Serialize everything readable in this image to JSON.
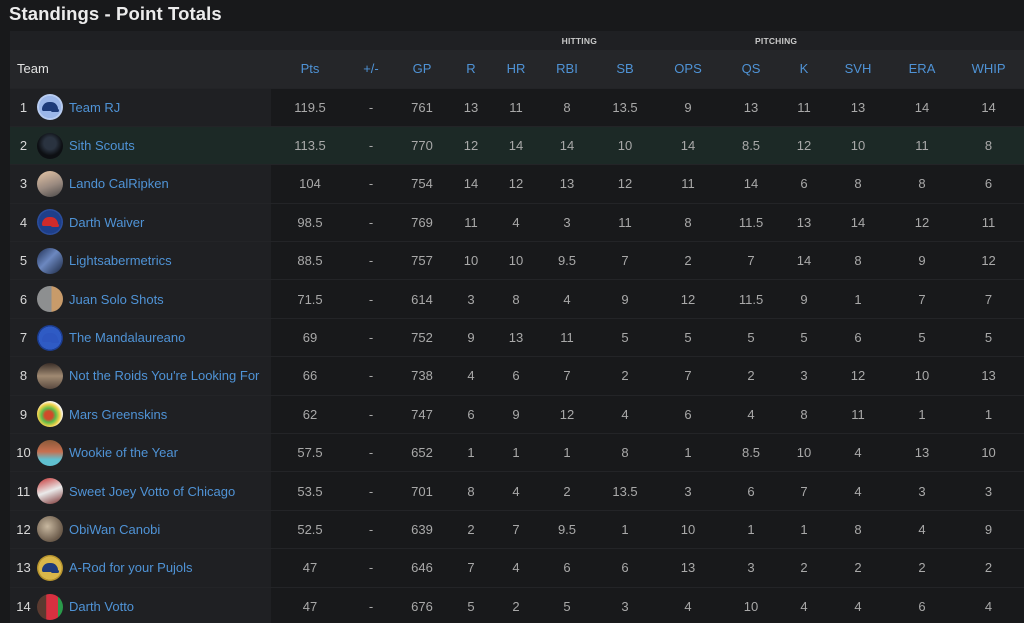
{
  "page": {
    "title": "Standings - Point Totals"
  },
  "colors": {
    "accent": "#4f93d6",
    "highlight_row": "#1c2926",
    "background": "#18191b"
  },
  "table": {
    "group_headers": {
      "hitting": "HITTING",
      "pitching": "PITCHING"
    },
    "columns": [
      "Team",
      "Pts",
      "+/-",
      "GP",
      "R",
      "HR",
      "RBI",
      "SB",
      "OPS",
      "QS",
      "K",
      "SVH",
      "ERA",
      "WHIP"
    ],
    "rows": [
      {
        "rank": "1",
        "team": "Team RJ",
        "avatar": "cap-blue-icon",
        "pts": "119.5",
        "change": "-",
        "gp": "761",
        "r": "13",
        "hr": "11",
        "rbi": "8",
        "sb": "13.5",
        "ops": "9",
        "qs": "13",
        "k": "11",
        "svh": "13",
        "era": "14",
        "whip": "14",
        "highlight": false
      },
      {
        "rank": "2",
        "team": "Sith Scouts",
        "avatar": "sith-photo-icon",
        "pts": "113.5",
        "change": "-",
        "gp": "770",
        "r": "12",
        "hr": "14",
        "rbi": "14",
        "sb": "10",
        "ops": "14",
        "qs": "8.5",
        "k": "12",
        "svh": "10",
        "era": "11",
        "whip": "8",
        "highlight": true
      },
      {
        "rank": "3",
        "team": "Lando CalRipken",
        "avatar": "person-photo-icon",
        "pts": "104",
        "change": "-",
        "gp": "754",
        "r": "14",
        "hr": "12",
        "rbi": "13",
        "sb": "12",
        "ops": "11",
        "qs": "14",
        "k": "6",
        "svh": "8",
        "era": "8",
        "whip": "6",
        "highlight": false
      },
      {
        "rank": "4",
        "team": "Darth Waiver",
        "avatar": "cap-red-icon",
        "pts": "98.5",
        "change": "-",
        "gp": "769",
        "r": "11",
        "hr": "4",
        "rbi": "3",
        "sb": "11",
        "ops": "8",
        "qs": "11.5",
        "k": "13",
        "svh": "14",
        "era": "12",
        "whip": "11",
        "highlight": false
      },
      {
        "rank": "5",
        "team": "Lightsabermetrics",
        "avatar": "lightsaber-photo-icon",
        "pts": "88.5",
        "change": "-",
        "gp": "757",
        "r": "10",
        "hr": "10",
        "rbi": "9.5",
        "sb": "7",
        "ops": "2",
        "qs": "7",
        "k": "14",
        "svh": "8",
        "era": "9",
        "whip": "12",
        "highlight": false
      },
      {
        "rank": "6",
        "team": "Juan Solo Shots",
        "avatar": "door-photo-icon",
        "pts": "71.5",
        "change": "-",
        "gp": "614",
        "r": "3",
        "hr": "8",
        "rbi": "4",
        "sb": "9",
        "ops": "12",
        "qs": "11.5",
        "k": "9",
        "svh": "1",
        "era": "7",
        "whip": "7",
        "highlight": false
      },
      {
        "rank": "7",
        "team": "The Mandalaureano",
        "avatar": "cap-royal-icon",
        "pts": "69",
        "change": "-",
        "gp": "752",
        "r": "9",
        "hr": "13",
        "rbi": "11",
        "sb": "5",
        "ops": "5",
        "qs": "5",
        "k": "5",
        "svh": "6",
        "era": "5",
        "whip": "5",
        "highlight": false
      },
      {
        "rank": "8",
        "team": "Not the Roids You're Looking For",
        "avatar": "room-photo-icon",
        "pts": "66",
        "change": "-",
        "gp": "738",
        "r": "4",
        "hr": "6",
        "rbi": "7",
        "sb": "2",
        "ops": "7",
        "qs": "2",
        "k": "3",
        "svh": "12",
        "era": "10",
        "whip": "13",
        "highlight": false
      },
      {
        "rank": "9",
        "team": "Mars Greenskins",
        "avatar": "cartoon-photo-icon",
        "pts": "62",
        "change": "-",
        "gp": "747",
        "r": "6",
        "hr": "9",
        "rbi": "12",
        "sb": "4",
        "ops": "6",
        "qs": "4",
        "k": "8",
        "svh": "11",
        "era": "1",
        "whip": "1",
        "highlight": false
      },
      {
        "rank": "10",
        "team": "Wookie of the Year",
        "avatar": "wookie-photo-icon",
        "pts": "57.5",
        "change": "-",
        "gp": "652",
        "r": "1",
        "hr": "1",
        "rbi": "1",
        "sb": "8",
        "ops": "1",
        "qs": "8.5",
        "k": "10",
        "svh": "4",
        "era": "13",
        "whip": "10",
        "highlight": false
      },
      {
        "rank": "11",
        "team": "Sweet Joey Votto of Chicago",
        "avatar": "player-photo-icon",
        "pts": "53.5",
        "change": "-",
        "gp": "701",
        "r": "8",
        "hr": "4",
        "rbi": "2",
        "sb": "13.5",
        "ops": "3",
        "qs": "6",
        "k": "7",
        "svh": "4",
        "era": "3",
        "whip": "3",
        "highlight": false
      },
      {
        "rank": "12",
        "team": "ObiWan Canobi",
        "avatar": "obiwan-photo-icon",
        "pts": "52.5",
        "change": "-",
        "gp": "639",
        "r": "2",
        "hr": "7",
        "rbi": "9.5",
        "sb": "1",
        "ops": "10",
        "qs": "1",
        "k": "1",
        "svh": "8",
        "era": "4",
        "whip": "9",
        "highlight": false
      },
      {
        "rank": "13",
        "team": "A-Rod for your Pujols",
        "avatar": "cap-gold-icon",
        "pts": "47",
        "change": "-",
        "gp": "646",
        "r": "7",
        "hr": "4",
        "rbi": "6",
        "sb": "6",
        "ops": "13",
        "qs": "3",
        "k": "2",
        "svh": "2",
        "era": "2",
        "whip": "2",
        "highlight": false
      },
      {
        "rank": "14",
        "team": "Darth Votto",
        "avatar": "card-photo-icon",
        "pts": "47",
        "change": "-",
        "gp": "676",
        "r": "5",
        "hr": "2",
        "rbi": "5",
        "sb": "3",
        "ops": "4",
        "qs": "10",
        "k": "4",
        "svh": "4",
        "era": "6",
        "whip": "4",
        "highlight": false
      }
    ]
  }
}
